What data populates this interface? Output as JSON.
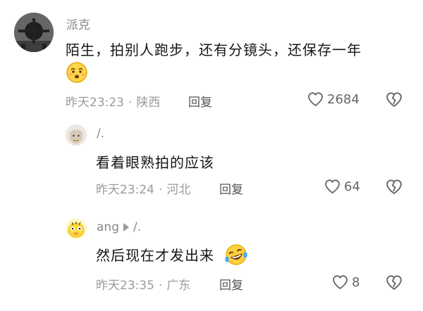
{
  "comments": [
    {
      "username": "派克",
      "text": "陌生，拍别人跑步，还有分镜头，还保存一年",
      "emoji": "worried-face-emoji",
      "time": "昨天23:23",
      "location": "陕西",
      "reply_label": "回复",
      "likes": "2684"
    },
    {
      "username": "/.",
      "text": "看着眼熟拍的应该",
      "time": "昨天23:24",
      "location": "河北",
      "reply_label": "回复",
      "likes": "64"
    },
    {
      "username": "ang",
      "reply_to": "/.",
      "text": "然后现在才发出来",
      "emoji": "laughing-tears-emoji",
      "time": "昨天23:35",
      "location": "广东",
      "reply_label": "回复",
      "likes": "8"
    }
  ],
  "icons": {
    "like": "heart-outline-icon",
    "dislike": "broken-heart-icon",
    "reply_arrow": "play-arrow-icon"
  },
  "colors": {
    "text": "#161616",
    "meta": "#9b9b9b",
    "username": "#8a8a8a"
  }
}
